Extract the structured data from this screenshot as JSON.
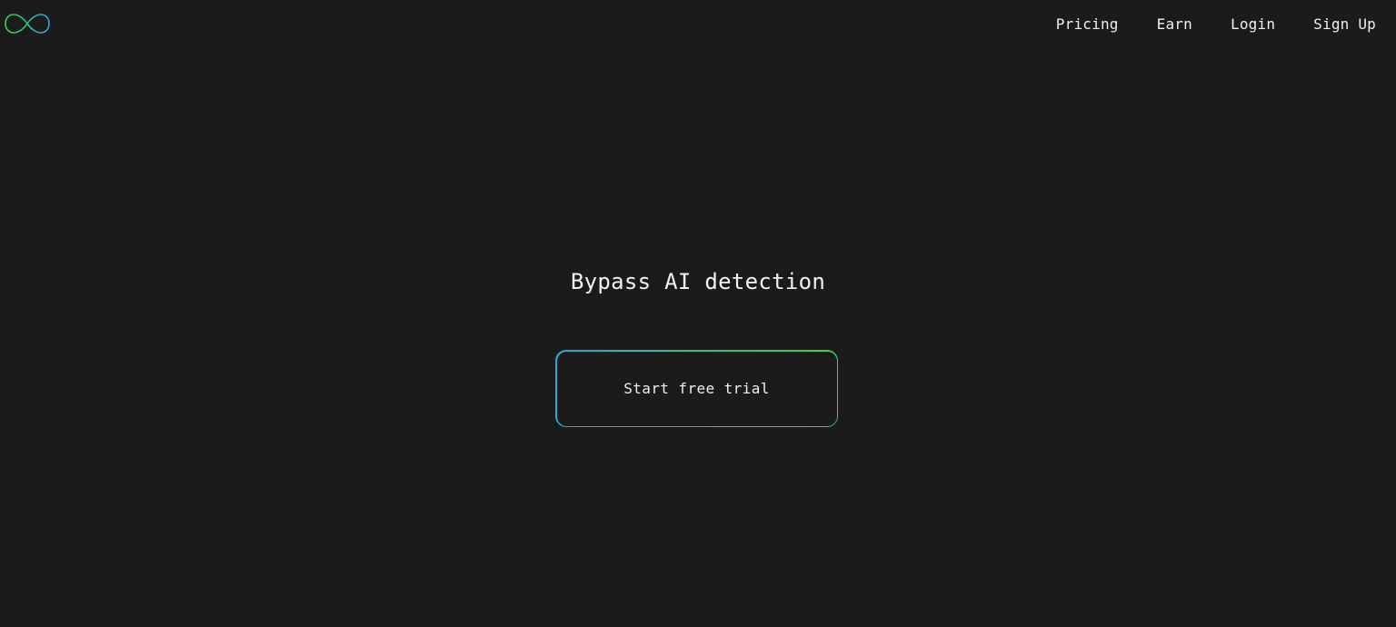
{
  "brand": {
    "logo_icon": "infinity-icon",
    "colors": {
      "gradient_start": "#2aa7d6",
      "gradient_mid": "#2fbf86",
      "gradient_end": "#3ed14a",
      "background": "#1b1b1b",
      "text": "#f0f0f0"
    }
  },
  "nav": {
    "items": [
      {
        "label": "Pricing"
      },
      {
        "label": "Earn"
      },
      {
        "label": "Login"
      },
      {
        "label": "Sign Up"
      }
    ]
  },
  "hero": {
    "title": "Bypass AI detection",
    "cta_label": "Start free trial"
  }
}
